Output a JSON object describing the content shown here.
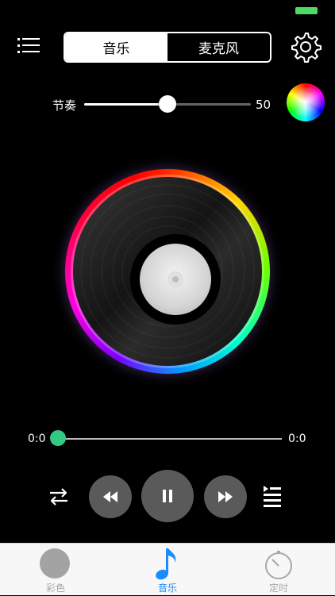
{
  "header": {
    "segments": [
      {
        "label": "音乐",
        "active": true
      },
      {
        "label": "麦克风",
        "active": false
      }
    ]
  },
  "rhythm": {
    "label": "节奏",
    "value": "50",
    "level": 0.5
  },
  "progress": {
    "elapsed": "0:0",
    "total": "0:0",
    "position": 0
  },
  "tabs": [
    {
      "label": "彩色",
      "icon": "color-circle-icon",
      "active": false
    },
    {
      "label": "音乐",
      "icon": "music-note-icon",
      "active": true
    },
    {
      "label": "定时",
      "icon": "timer-icon",
      "active": false
    }
  ],
  "colors": {
    "background": "#000000",
    "accent_green": "#34c983",
    "battery": "#4cd964",
    "tab_active": "#1a8cff",
    "tab_inactive": "#a8a8a8",
    "button_gray": "#5a5a5a"
  }
}
